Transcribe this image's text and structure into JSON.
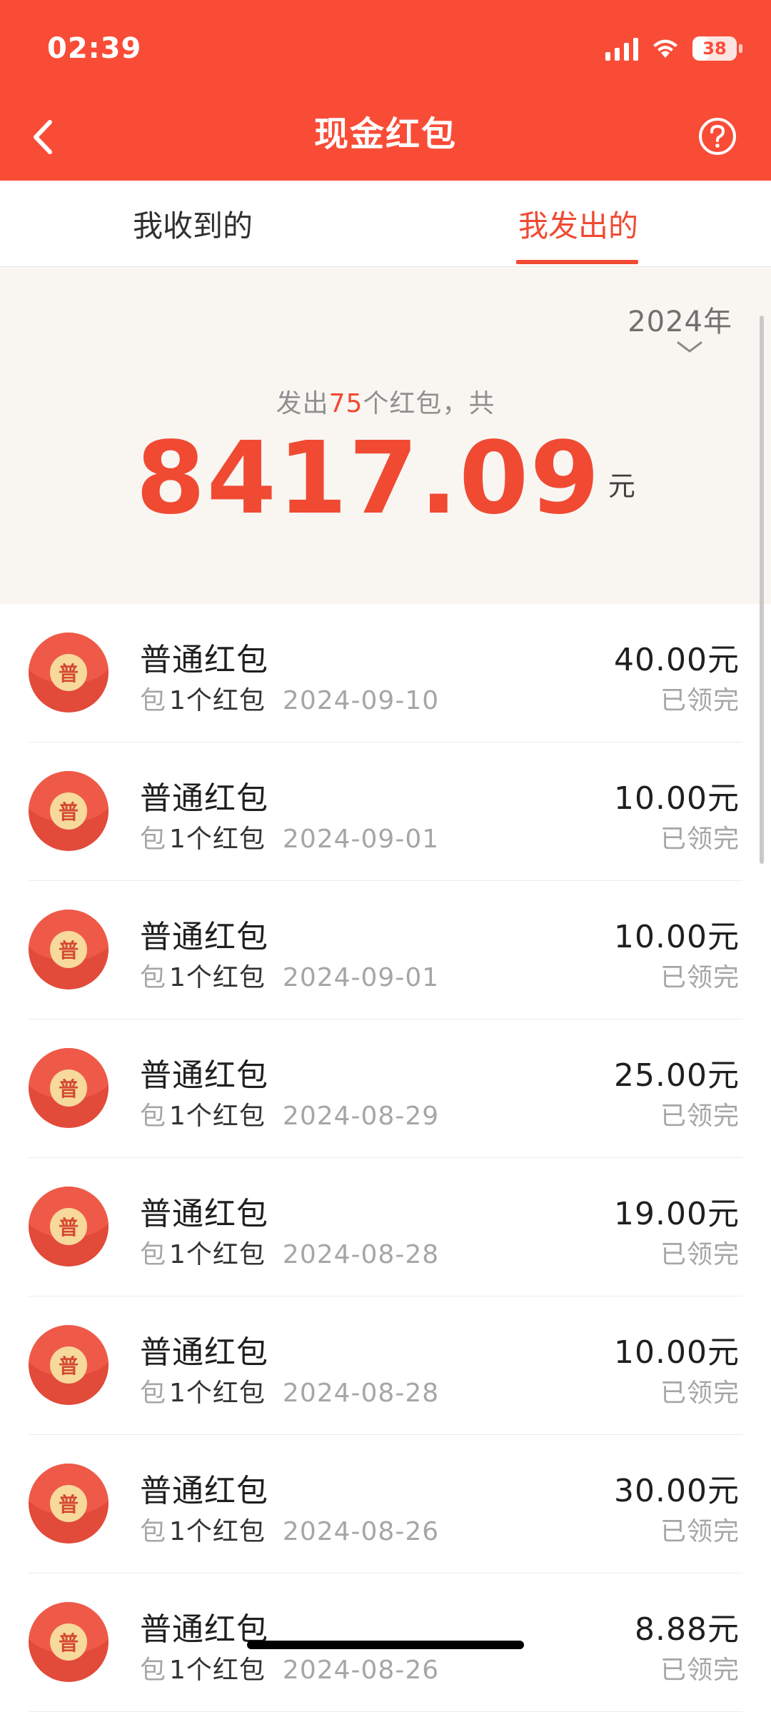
{
  "status_bar": {
    "time": "02:39",
    "battery": "38",
    "battery_fill_fraction": 0.38
  },
  "header": {
    "title": "现金红包"
  },
  "tabs": [
    {
      "label": "我收到的",
      "active": false
    },
    {
      "label": "我发出的",
      "active": true
    }
  ],
  "summary": {
    "year": "2024年",
    "prefix": "发出",
    "count": "75",
    "suffix": "个红包，共",
    "total": "8417.09",
    "unit": "元"
  },
  "list": [
    {
      "title": "普通红包",
      "bag": "包",
      "qty": "1个红包",
      "date": "2024-09-10",
      "amount": "40.00元",
      "status": "已领完",
      "seal": "普"
    },
    {
      "title": "普通红包",
      "bag": "包",
      "qty": "1个红包",
      "date": "2024-09-01",
      "amount": "10.00元",
      "status": "已领完",
      "seal": "普"
    },
    {
      "title": "普通红包",
      "bag": "包",
      "qty": "1个红包",
      "date": "2024-09-01",
      "amount": "10.00元",
      "status": "已领完",
      "seal": "普"
    },
    {
      "title": "普通红包",
      "bag": "包",
      "qty": "1个红包",
      "date": "2024-08-29",
      "amount": "25.00元",
      "status": "已领完",
      "seal": "普"
    },
    {
      "title": "普通红包",
      "bag": "包",
      "qty": "1个红包",
      "date": "2024-08-28",
      "amount": "19.00元",
      "status": "已领完",
      "seal": "普"
    },
    {
      "title": "普通红包",
      "bag": "包",
      "qty": "1个红包",
      "date": "2024-08-28",
      "amount": "10.00元",
      "status": "已领完",
      "seal": "普"
    },
    {
      "title": "普通红包",
      "bag": "包",
      "qty": "1个红包",
      "date": "2024-08-26",
      "amount": "30.00元",
      "status": "已领完",
      "seal": "普"
    },
    {
      "title": "普通红包",
      "bag": "包",
      "qty": "1个红包",
      "date": "2024-08-26",
      "amount": "8.88元",
      "status": "已领完",
      "seal": "普"
    }
  ],
  "colors": {
    "header_red": "#f94c37",
    "accent_red": "#f04a33",
    "summary_bg": "#f9f6f2"
  },
  "icons": {
    "back": "chevron-left-icon",
    "help": "question-circle-icon",
    "year_toggle": "chevron-down-icon",
    "signal": "signal-icon",
    "wifi": "wifi-icon",
    "battery": "battery-icon",
    "envelope": "red-envelope-icon"
  }
}
